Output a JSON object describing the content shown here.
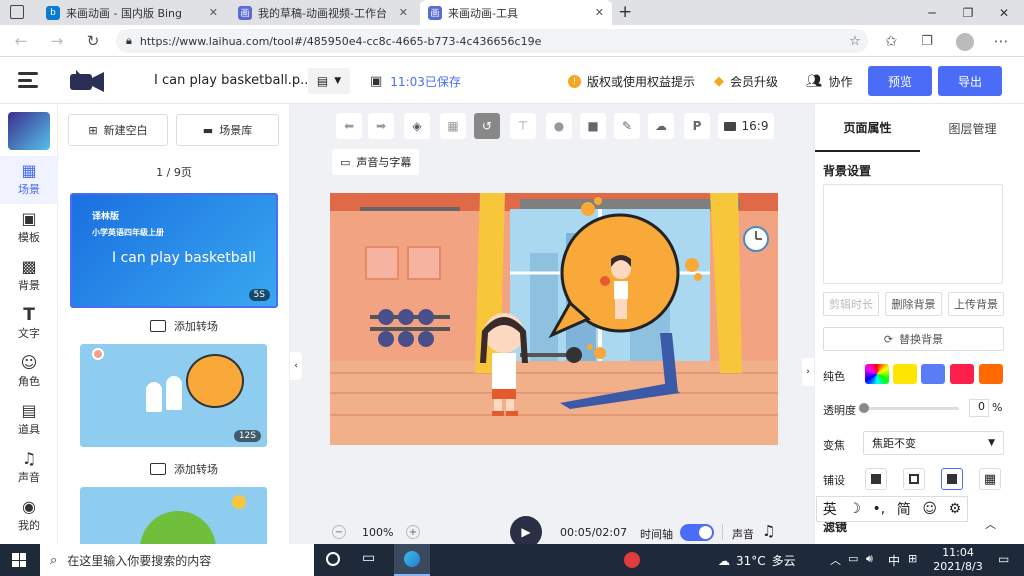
{
  "browser": {
    "tabs": [
      {
        "title": "来画动画 - 国内版 Bing",
        "icon": "bing-icon"
      },
      {
        "title": "我的草稿-动画视频-工作台",
        "icon": "laihua-icon"
      },
      {
        "title": "来画动画-工具",
        "icon": "laihua-icon"
      }
    ],
    "url": "https://www.laihua.com/tool#/485950e4-cc8c-4665-b773-4c436656c19e"
  },
  "header": {
    "title": "I can play basketball.p...",
    "save_time": "11:03已保存",
    "copyright": "版权或使用权益提示",
    "upgrade": "会员升级",
    "collab": "协作",
    "preview": "预览",
    "export": "导出"
  },
  "rail": {
    "items": [
      {
        "label": "场景",
        "icon": "scene-icon",
        "glyph": "▦"
      },
      {
        "label": "模板",
        "icon": "template-icon",
        "glyph": "▣"
      },
      {
        "label": "背景",
        "icon": "background-icon",
        "glyph": "▩"
      },
      {
        "label": "文字",
        "icon": "text-icon",
        "glyph": "T"
      },
      {
        "label": "角色",
        "icon": "character-icon",
        "glyph": "☺"
      },
      {
        "label": "道具",
        "icon": "prop-icon",
        "glyph": "▤"
      },
      {
        "label": "声音",
        "icon": "music-icon",
        "glyph": "♫"
      },
      {
        "label": "我的",
        "icon": "user-icon",
        "glyph": "◉"
      }
    ]
  },
  "scenes": {
    "new_blank": "新建空白",
    "library": "场景库",
    "page_count": "1 / 9页",
    "scene1": {
      "publisher": "译林版",
      "grade": "小学英语四年级上册",
      "title": "I can play basketball",
      "duration": "5S"
    },
    "scene2": {
      "duration": "12S"
    },
    "add_transition": "添加转场"
  },
  "toolbar": {
    "ratio": "16:9",
    "sound_subtitle": "声音与字幕"
  },
  "playbar": {
    "zoom": "100%",
    "time": "00:05/02:07",
    "timeline": "时间轴",
    "audio": "声音"
  },
  "props": {
    "tab_page": "页面属性",
    "tab_layers": "图层管理",
    "bg_settings": "背景设置",
    "cut_duration": "剪辑时长",
    "delete_bg": "删除背景",
    "upload_bg": "上传背景",
    "replace_bg": "替换背景",
    "solid_color": "纯色",
    "opacity": "透明度",
    "opacity_value": "0",
    "opacity_unit": "%",
    "zoom_label": "变焦",
    "zoom_value": "焦距不变",
    "layout": "铺设",
    "filter": "滤镜",
    "colors": [
      "#ff4fa0",
      "#ffe600",
      "#5a7cf5",
      "#ff1f4b",
      "#ff6a00"
    ]
  },
  "ime": {
    "lang": "英",
    "simp": "简"
  },
  "taskbar": {
    "search": "在这里输入你要搜索的内容",
    "temp": "31°C",
    "weather": "多云",
    "ime": "中",
    "time": "11:04",
    "date": "2021/8/3"
  }
}
